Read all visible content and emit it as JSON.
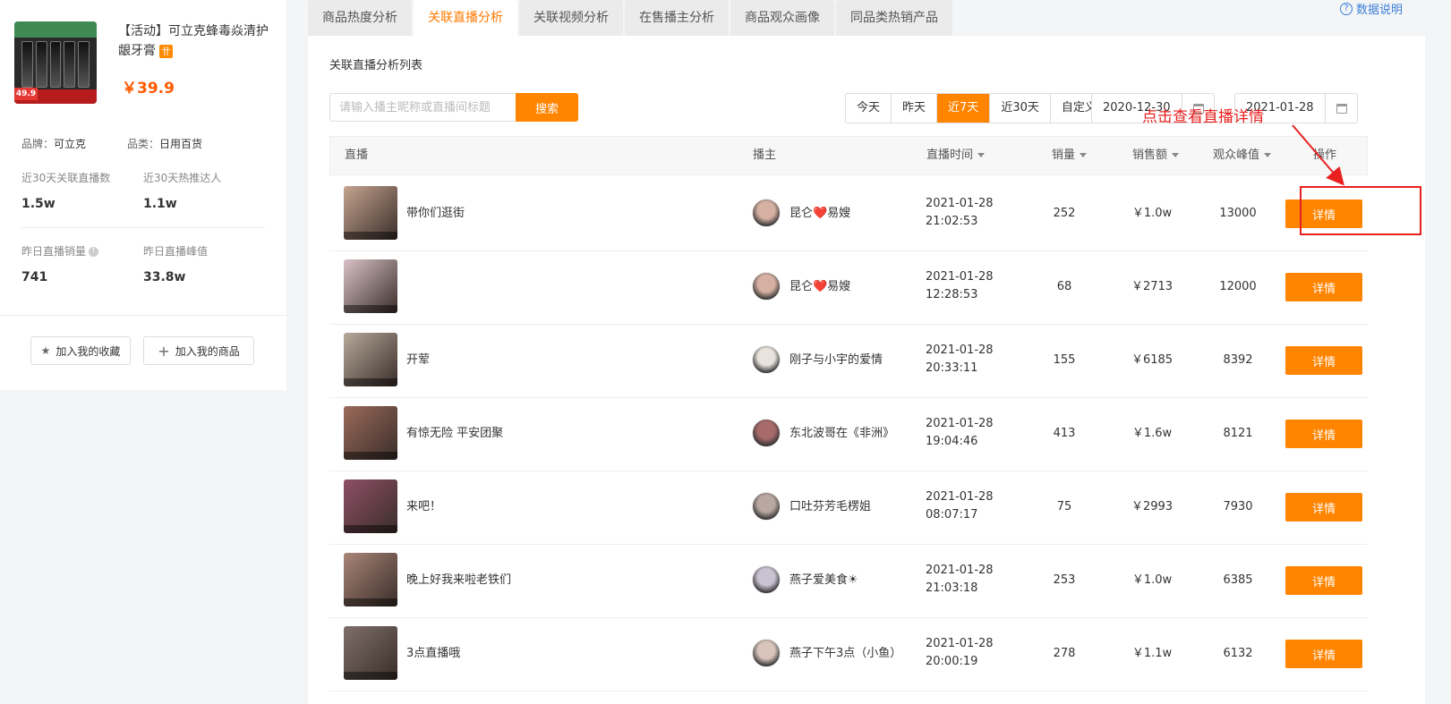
{
  "product": {
    "title": "【活动】可立克蜂毒焱清护龈牙膏",
    "badge": "〹",
    "price": "￥39.9",
    "image_label": "49.9"
  },
  "meta": {
    "brand_label": "品牌：",
    "brand": "可立克",
    "category_label": "品类：",
    "category": "日用百货"
  },
  "stats": [
    {
      "label": "近30天关联直播数",
      "value": "1.5w"
    },
    {
      "label": "近30天热推达人",
      "value": "1.1w"
    },
    {
      "label": "昨日直播销量",
      "value": "741"
    },
    {
      "label": "昨日直播峰值",
      "value": "33.8w"
    }
  ],
  "actions": {
    "collect": "加入我的收藏",
    "add_product": "加入我的商品"
  },
  "tabs": [
    {
      "label": "商品热度分析",
      "active": false
    },
    {
      "label": "关联直播分析",
      "active": true
    },
    {
      "label": "关联视频分析",
      "active": false
    },
    {
      "label": "在售播主分析",
      "active": false
    },
    {
      "label": "商品观众画像",
      "active": false
    },
    {
      "label": "同品类热销产品",
      "active": false
    }
  ],
  "help": "数据说明",
  "section_title": "关联直播分析列表",
  "search": {
    "placeholder": "请输入播主昵称或直播间标题",
    "button": "搜索"
  },
  "ranges": [
    {
      "label": "今天",
      "active": false
    },
    {
      "label": "昨天",
      "active": false
    },
    {
      "label": "近7天",
      "active": true
    },
    {
      "label": "近30天",
      "active": false
    },
    {
      "label": "自定义",
      "active": false
    }
  ],
  "date_start": "2020-12-30",
  "date_end": "2021-01-28",
  "annotation": "点击查看直播详情",
  "table": {
    "headers": {
      "live": "直播",
      "anchor": "播主",
      "time": "直播时间",
      "sales": "销量",
      "revenue": "销售额",
      "peak": "观众峰值",
      "action": "操作"
    },
    "detail_label": "详情",
    "rows": [
      {
        "title": "带你们逛街",
        "anchor": "昆仑❤️易嫂",
        "date": "2021-01-28",
        "time": "21:02:53",
        "sales": "252",
        "revenue": "￥1.0w",
        "peak": "13000"
      },
      {
        "title": "",
        "anchor": "昆仑❤️易嫂",
        "date": "2021-01-28",
        "time": "12:28:53",
        "sales": "68",
        "revenue": "￥2713",
        "peak": "12000"
      },
      {
        "title": "开荤",
        "anchor": "刚子与小宇的爱情",
        "date": "2021-01-28",
        "time": "20:33:11",
        "sales": "155",
        "revenue": "￥6185",
        "peak": "8392"
      },
      {
        "title": "有惊无险 平安团聚",
        "anchor": "东北波哥在《非洲》",
        "date": "2021-01-28",
        "time": "19:04:46",
        "sales": "413",
        "revenue": "￥1.6w",
        "peak": "8121"
      },
      {
        "title": "来吧！",
        "anchor": "口吐芬芳毛楞姐",
        "date": "2021-01-28",
        "time": "08:07:17",
        "sales": "75",
        "revenue": "￥2993",
        "peak": "7930"
      },
      {
        "title": "晚上好我来啦老铁们",
        "anchor": "燕子爱美食☀",
        "date": "2021-01-28",
        "time": "21:03:18",
        "sales": "253",
        "revenue": "￥1.0w",
        "peak": "6385"
      },
      {
        "title": "3点直播哦",
        "anchor": "燕子下午3点（小鱼）",
        "date": "2021-01-28",
        "time": "20:00:19",
        "sales": "278",
        "revenue": "￥1.1w",
        "peak": "6132"
      }
    ]
  },
  "colors": {
    "accent": "#ff8400",
    "price": "#ff5a00",
    "annotation": "#e82020",
    "link": "#3a7fd5"
  }
}
